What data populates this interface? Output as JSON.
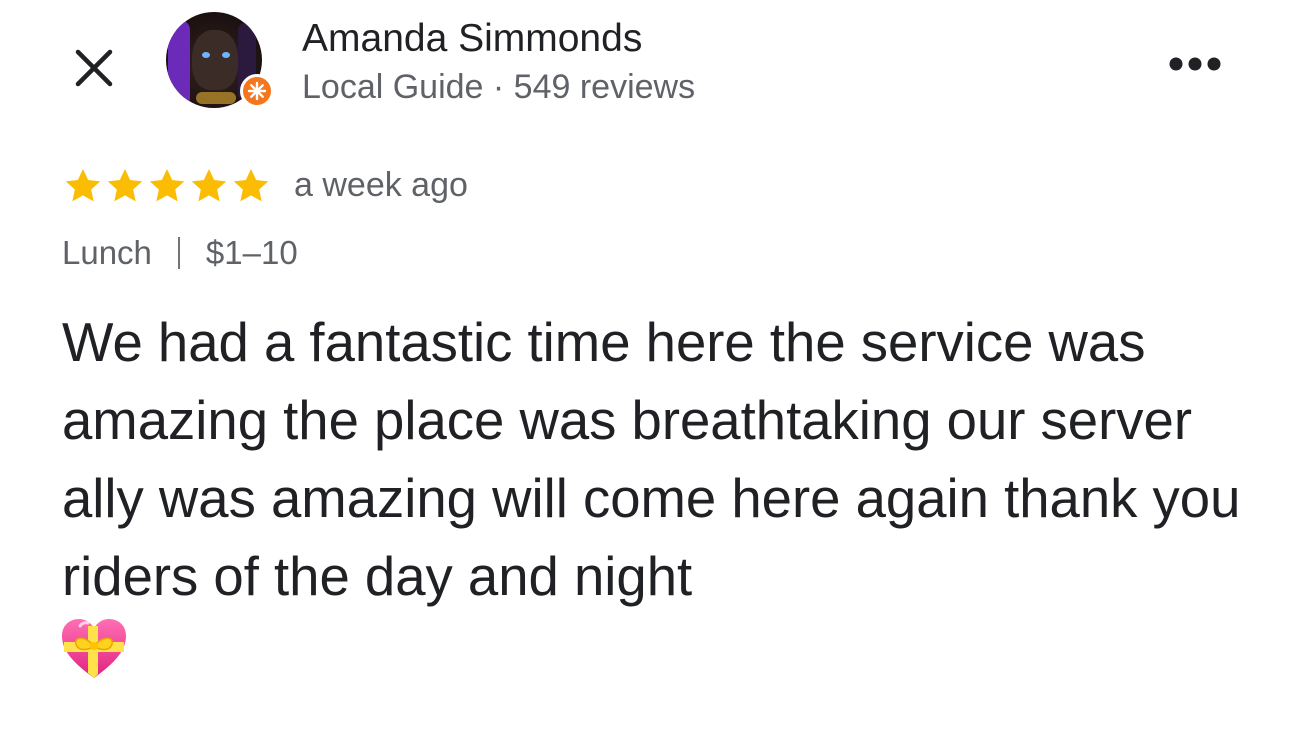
{
  "reviewer": {
    "name": "Amanda Simmonds",
    "meta": "Local Guide · 549 reviews"
  },
  "header": {
    "close_icon": "close-icon",
    "more_icon": "more-horizontal-icon"
  },
  "review": {
    "rating": 5,
    "rating_max": 5,
    "time": "a week ago",
    "meal": "Lunch",
    "price": "$1–10",
    "text": "We had a fantastic time here the service was amazing the place was breathtaking our server ally was amazing will come here again thank you riders of the day and night",
    "emoji": "heart-with-ribbon-icon"
  },
  "colors": {
    "star": "#fbbc04",
    "local_guide_badge": "#f2771e",
    "primary_text": "#202124",
    "secondary_text": "#5f6368"
  }
}
